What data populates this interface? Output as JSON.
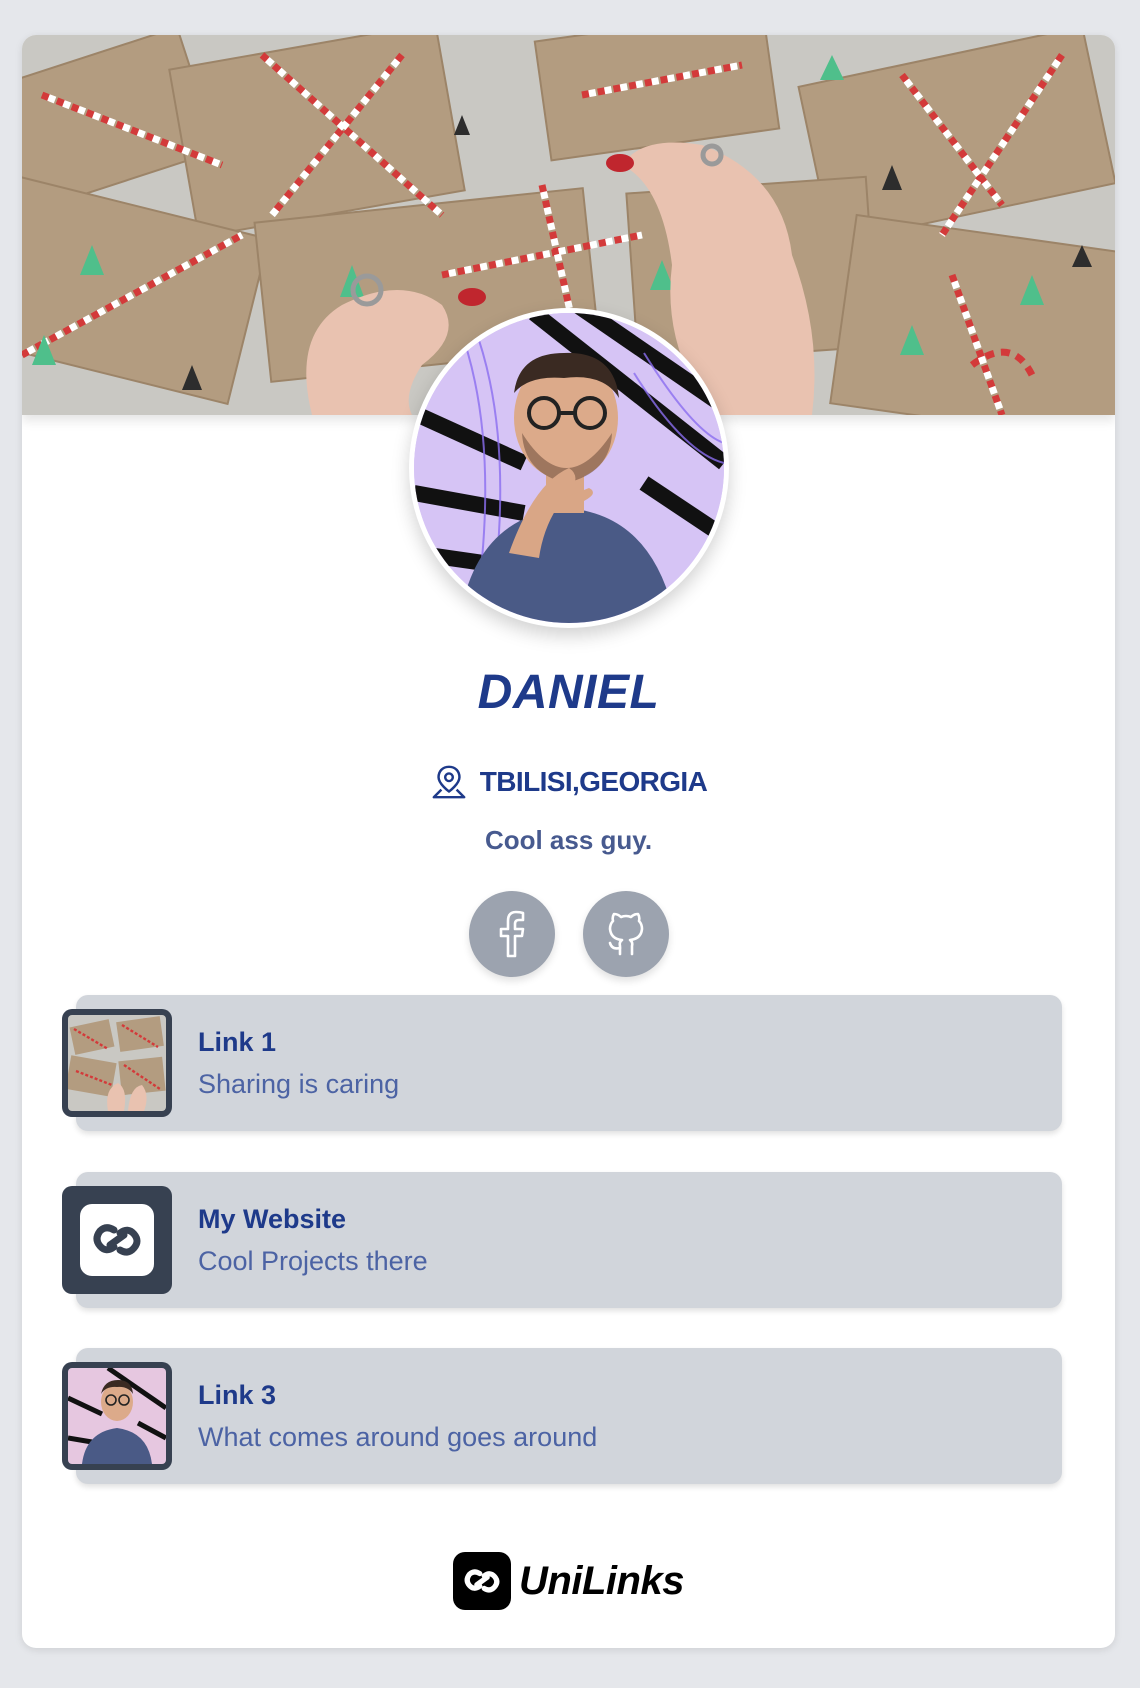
{
  "profile": {
    "name": "DANIEL",
    "location": "TBILISI,GEORGIA",
    "bio": "Cool ass guy."
  },
  "socials": [
    {
      "name": "facebook",
      "icon": "facebook-icon"
    },
    {
      "name": "github",
      "icon": "github-icon"
    }
  ],
  "links": [
    {
      "title": "Link 1",
      "subtitle": "Sharing is caring",
      "thumb": "gifts-photo"
    },
    {
      "title": "My Website",
      "subtitle": "Cool Projects there",
      "thumb": "link-logo-icon"
    },
    {
      "title": "Link 3",
      "subtitle": "What comes around goes around",
      "thumb": "portrait-photo"
    }
  ],
  "footer": {
    "brand": "UniLinks"
  },
  "colors": {
    "accent": "#1e3a8a",
    "muted": "#4c63a4",
    "link_bg": "#d1d5db",
    "thumb_frame": "#374151",
    "page_bg": "#e5e7eb"
  }
}
